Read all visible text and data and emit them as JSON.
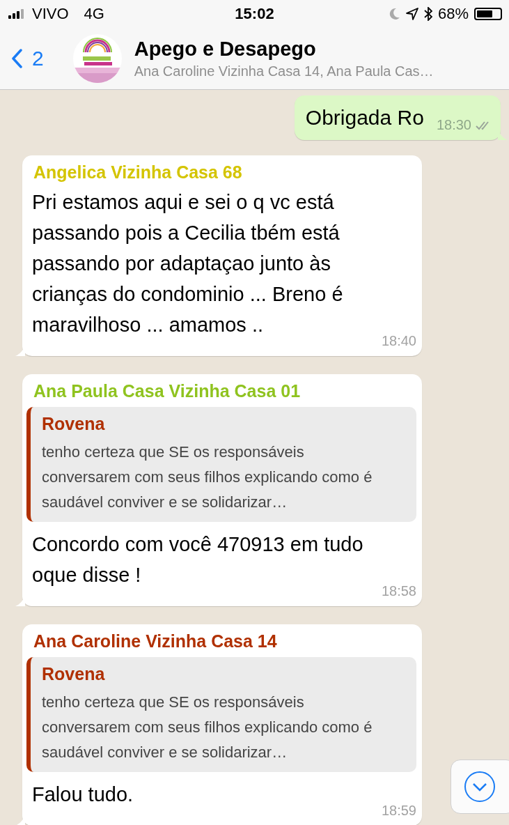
{
  "status_bar": {
    "carrier": "VIVO",
    "network": "4G",
    "time": "15:02",
    "battery": "68%"
  },
  "header": {
    "back_count": "2",
    "title": "Apego e Desapego",
    "subtitle": "Ana Caroline Vizinha Casa 14, Ana Paula Cas…"
  },
  "messages": [
    {
      "kind": "outgoing",
      "text": "Obrigada Ro",
      "time": "18:30",
      "read": false
    },
    {
      "kind": "incoming",
      "sender": "Angelica Vizinha Casa 68",
      "color": "#d4c400",
      "text": "Pri estamos aqui e sei o q vc está passando pois a Cecilia tbém está passando por adaptaçao junto às crianças do condominio ... Breno é maravilhoso ... amamos ..",
      "time": "18:40"
    },
    {
      "kind": "incoming",
      "sender": "Ana Paula Casa Vizinha Casa 01",
      "color": "#8fc31f",
      "quote": {
        "sender": "Rovena",
        "color": "#b03000",
        "text": "tenho certeza que SE os responsáveis conversarem com seus filhos explicando como é  saudável conviver e se solidarizar…"
      },
      "text": "Concordo com você 470913 em tudo oque disse !",
      "time": "18:58"
    },
    {
      "kind": "incoming",
      "sender": "Ana Caroline Vizinha Casa 14",
      "color": "#b03000",
      "quote": {
        "sender": "Rovena",
        "color": "#b03000",
        "text": "tenho certeza que SE os responsáveis conversarem com seus filhos explicando como é  saudável conviver e se solidarizar…"
      },
      "text": "Falou tudo.",
      "time": "18:59"
    }
  ]
}
